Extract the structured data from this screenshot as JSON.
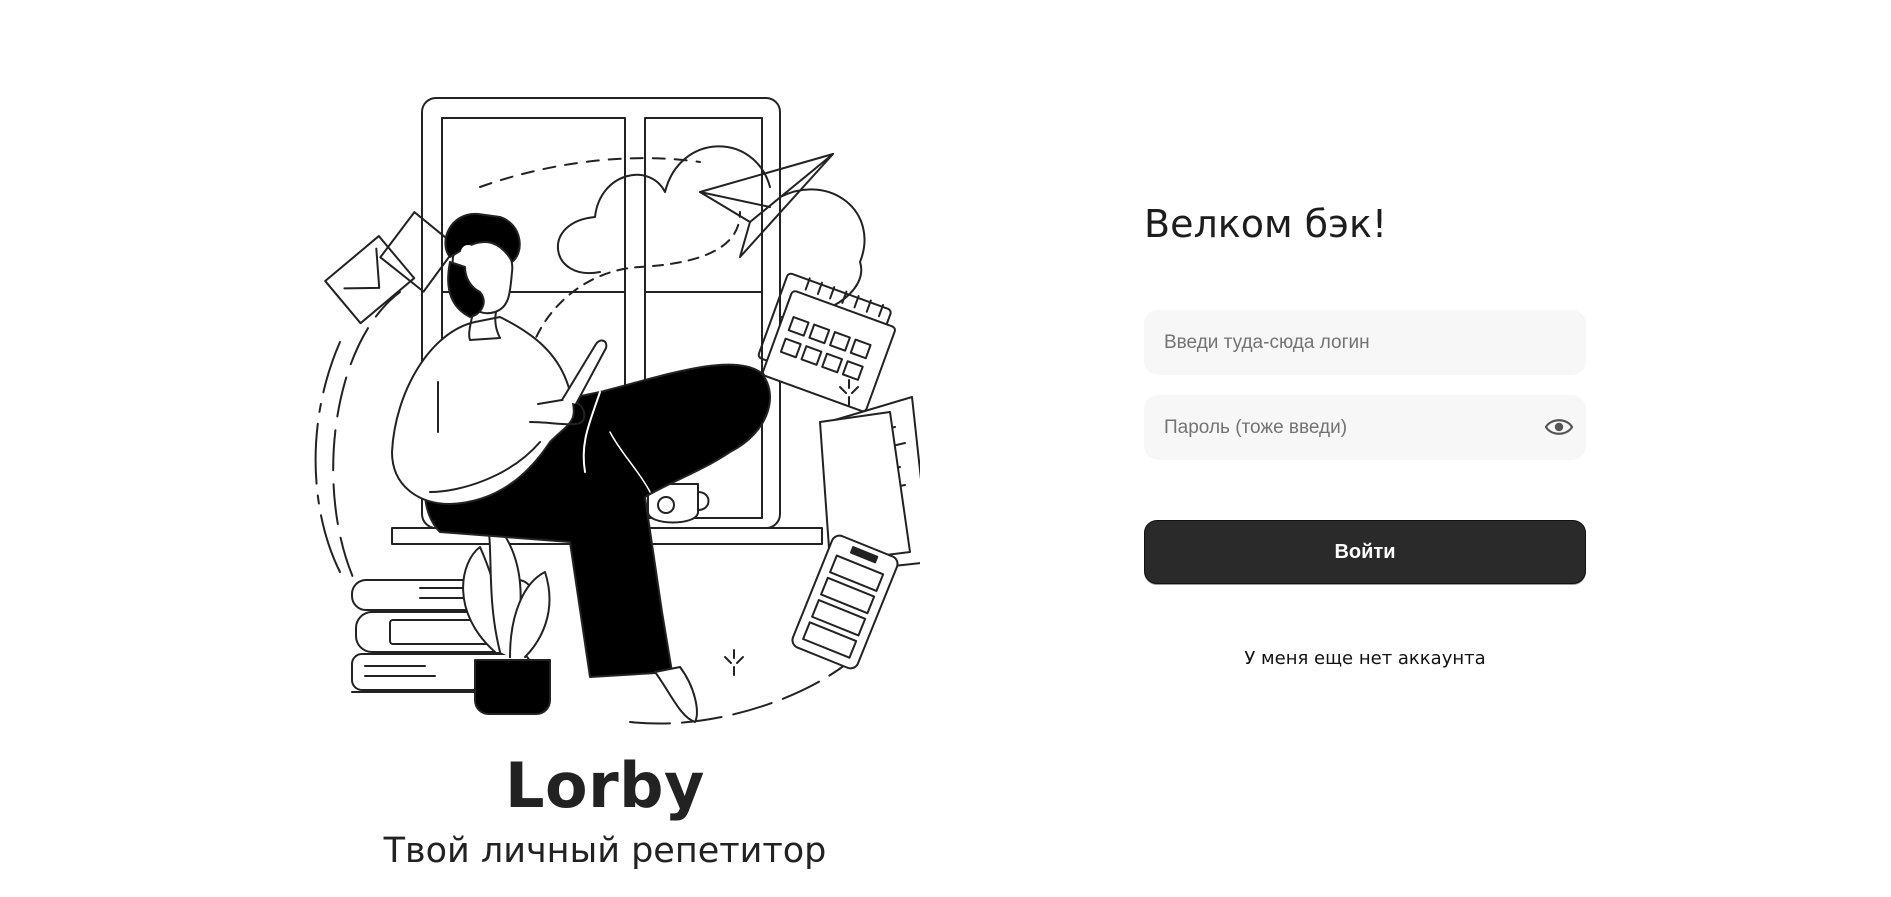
{
  "brand": {
    "title": "Lorby",
    "subtitle": "Твой личный репетитор"
  },
  "form": {
    "heading": "Велком бэк!",
    "login_placeholder": "Введи туда-сюда логин",
    "login_value": "",
    "password_placeholder": "Пароль (тоже введи)",
    "password_value": "",
    "password_toggle_icon": "eye-icon",
    "submit_label": "Войти",
    "register_link": "У меня еще нет аккаунта"
  },
  "colors": {
    "background": "#ffffff",
    "field_background": "#f7f7f7",
    "button_background": "#2a2a2a",
    "button_text": "#ffffff",
    "text_primary": "#1d1d1d"
  }
}
